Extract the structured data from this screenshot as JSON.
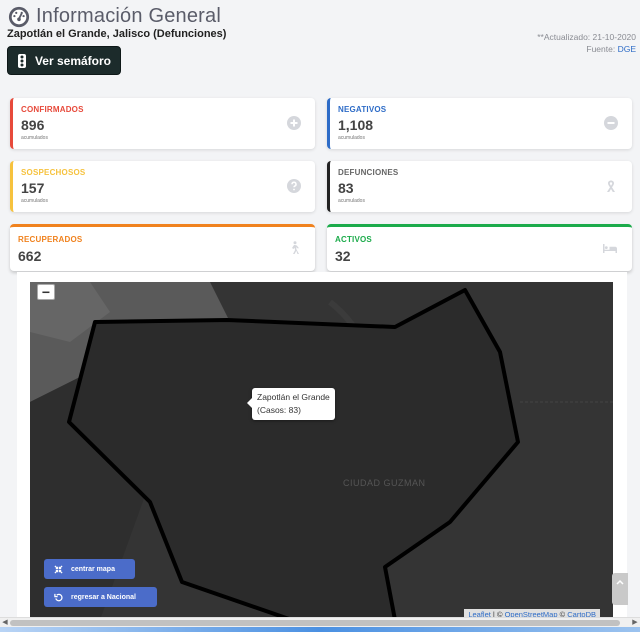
{
  "header": {
    "title": "Información General",
    "subtitle": "Zapotlán el Grande, Jalisco (Defunciones)",
    "updated": "**Actualizado: 21-10-2020",
    "source_label": "Fuente:",
    "source_link": "DGE",
    "semaforo_button": "Ver semáforo"
  },
  "cards": [
    {
      "label": "CONFIRMADOS",
      "value": "896",
      "sub": "acumulados",
      "color": "#e74a3b",
      "icon": "plus-circle-icon"
    },
    {
      "label": "NEGATIVOS",
      "value": "1,108",
      "sub": "acumulados",
      "color": "#2e6cc7",
      "icon": "minus-circle-icon"
    },
    {
      "label": "SOSPECHOSOS",
      "value": "157",
      "sub": "acumulados",
      "color": "#f6c23e",
      "icon": "question-circle-icon"
    },
    {
      "label": "DEFUNCIONES",
      "value": "83",
      "sub": "acumulados",
      "color": "#222222",
      "icon": "ribbon-icon"
    },
    {
      "label": "RECUPERADOS",
      "value": "662",
      "color": "#f0821e",
      "icon": "walking-icon"
    },
    {
      "label": "ACTIVOS",
      "value": "32",
      "color": "#1cab4b",
      "icon": "bed-icon"
    }
  ],
  "map": {
    "zoom_out": "−",
    "tooltip_name": "Zapotlán el Grande",
    "tooltip_cases": "(Casos: 83)",
    "city_label": "CIUDAD GUZMAN",
    "center_button": "centrar mapa",
    "back_button": "regresar a Nacional",
    "attribution": {
      "leaflet": "Leaflet",
      "sep1": " | © ",
      "osm": "OpenStreetMap",
      "sep2": " © ",
      "carto": "CartoDB"
    }
  }
}
